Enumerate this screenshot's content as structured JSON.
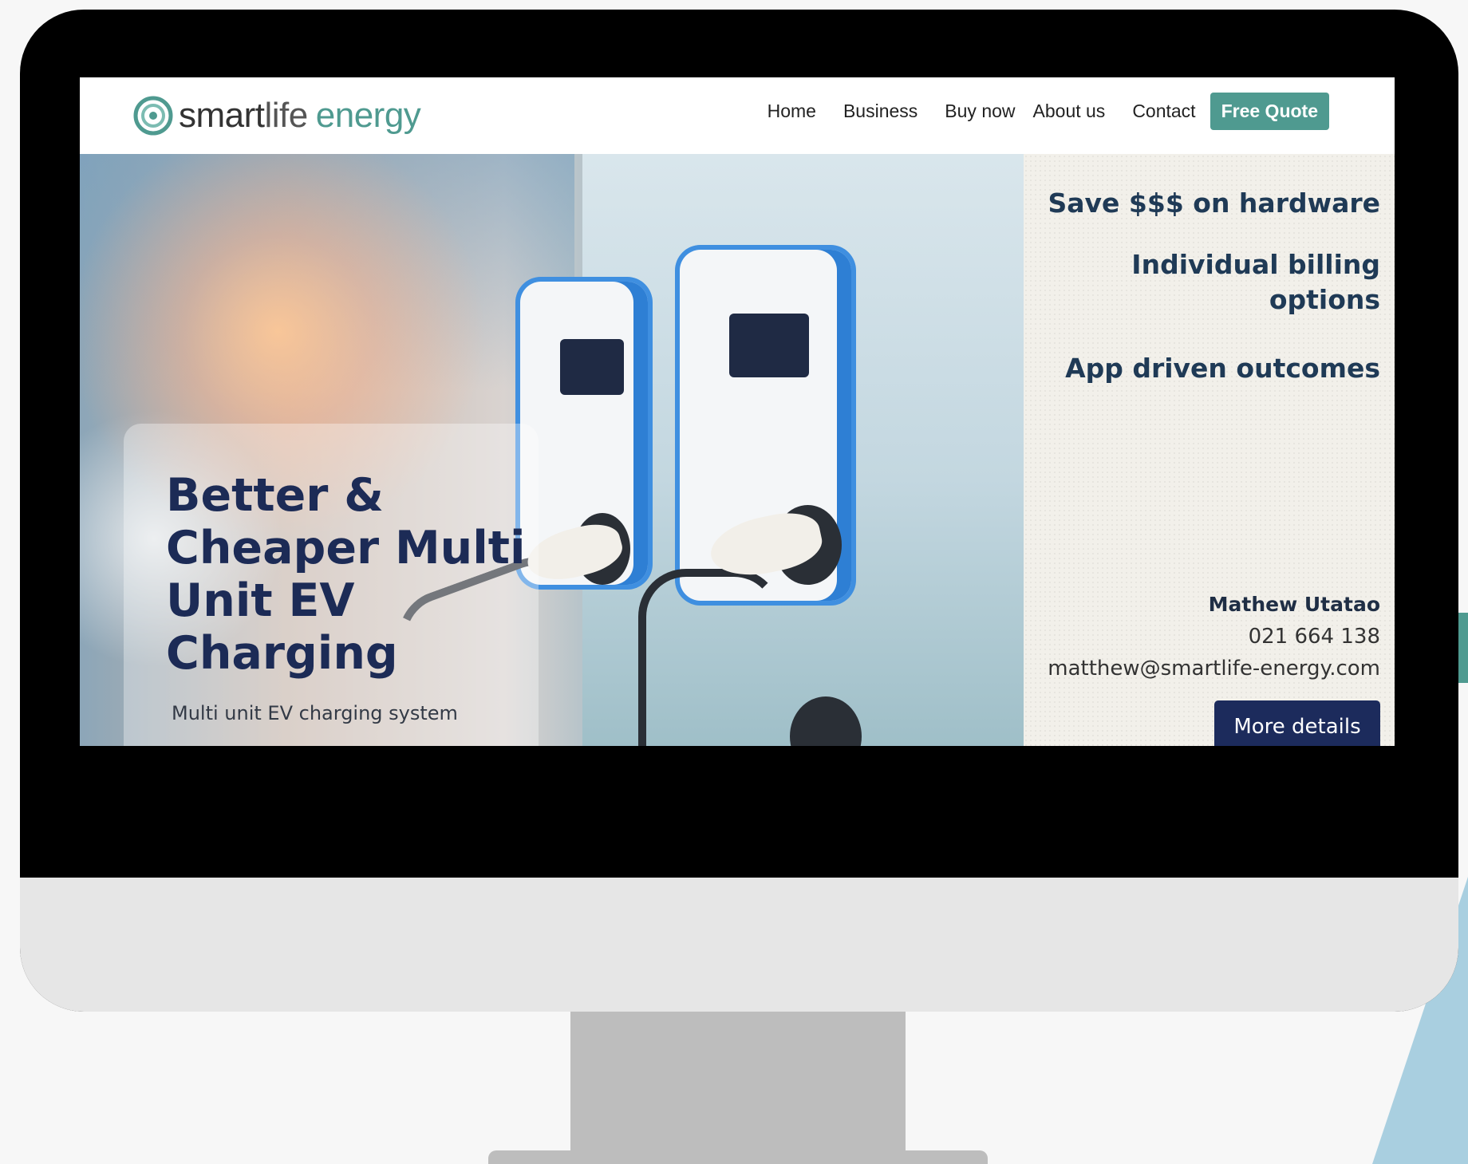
{
  "brand": {
    "name_part1": "smart",
    "name_part2": "life",
    "name_part3": "energy",
    "logo_icon": "swirl-logo-icon",
    "accent_color": "#4f9a90",
    "navy_color": "#1c2b5c"
  },
  "nav": {
    "items": [
      {
        "label": "Home"
      },
      {
        "label": "Business"
      },
      {
        "label": "Buy now"
      },
      {
        "label": "About us"
      },
      {
        "label": "Contact"
      }
    ],
    "cta_label": "Free Quote"
  },
  "hero": {
    "title": "Better & Cheaper Multi Unit EV Charging",
    "subtitle": "Multi unit EV charging system"
  },
  "features": [
    {
      "label": "Save $$$ on hardware"
    },
    {
      "label": "Individual billing options"
    },
    {
      "label": "App driven outcomes"
    }
  ],
  "contact": {
    "name": "Mathew Utatao",
    "phone": "021 664 138",
    "email": "matthew@smartlife-energy.com",
    "button_label": "More details"
  }
}
